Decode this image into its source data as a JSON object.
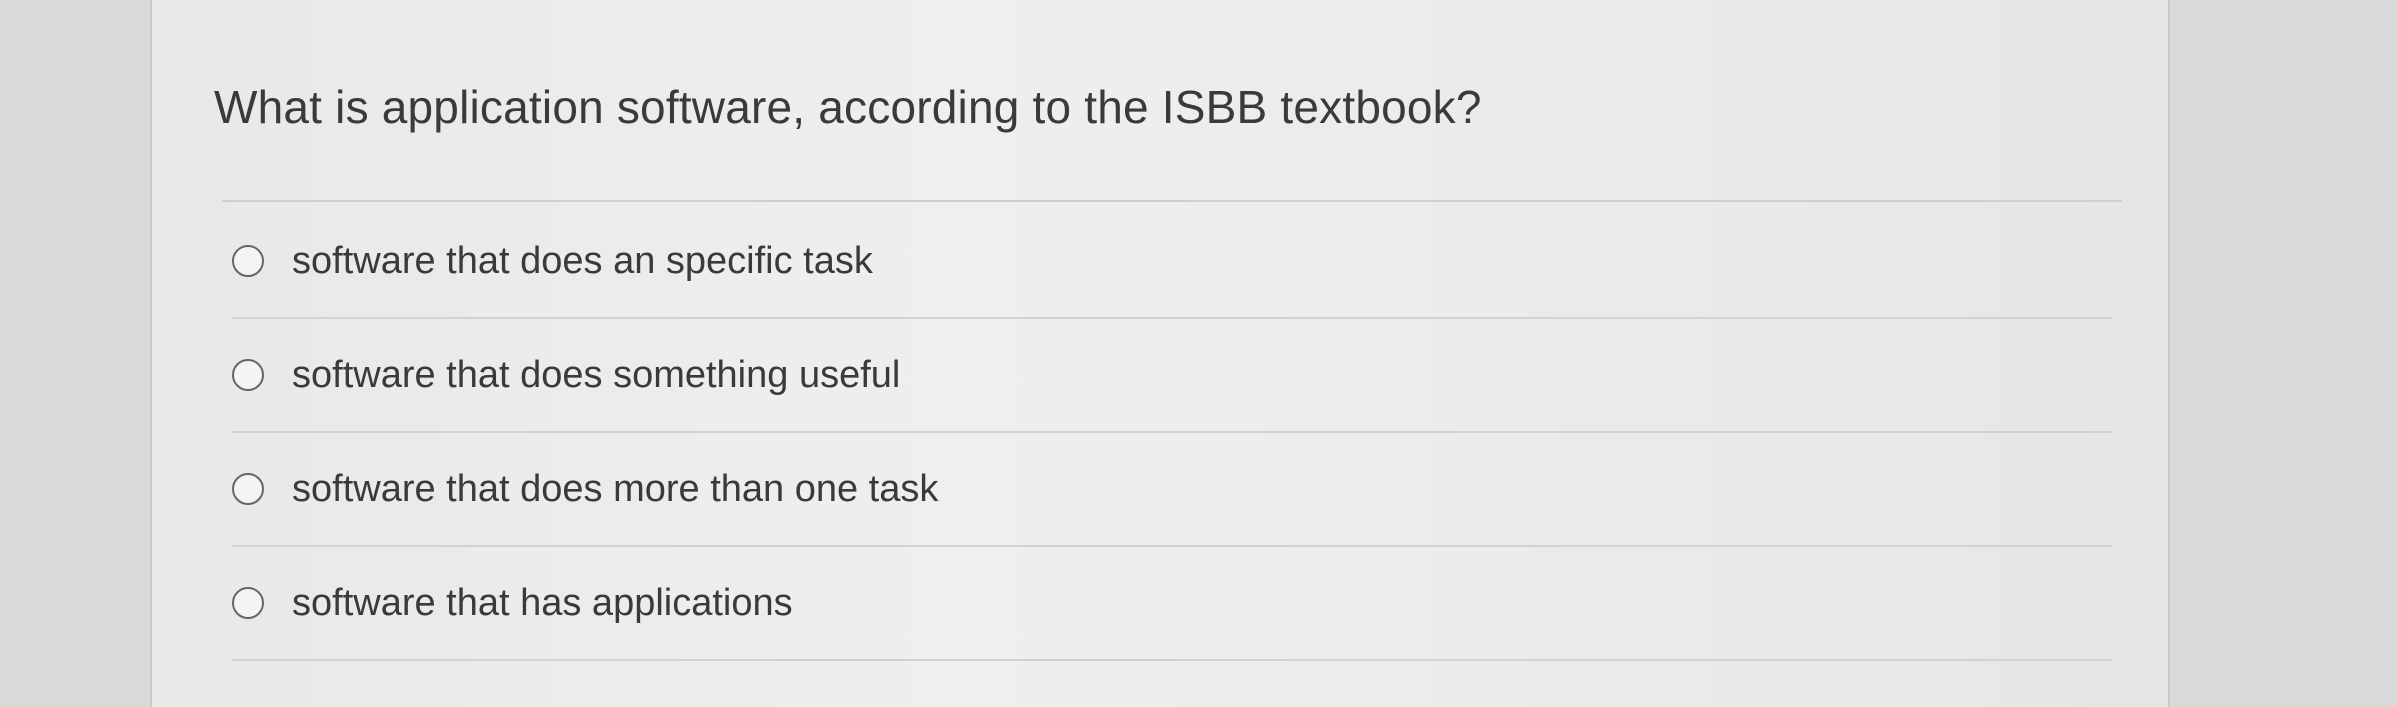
{
  "question": {
    "text": "What is application software, according to the ISBB textbook?"
  },
  "options": [
    {
      "label": "software that does an specific task"
    },
    {
      "label": "software that does something useful"
    },
    {
      "label": "software that does more than one task"
    },
    {
      "label": "software that has applications"
    }
  ]
}
